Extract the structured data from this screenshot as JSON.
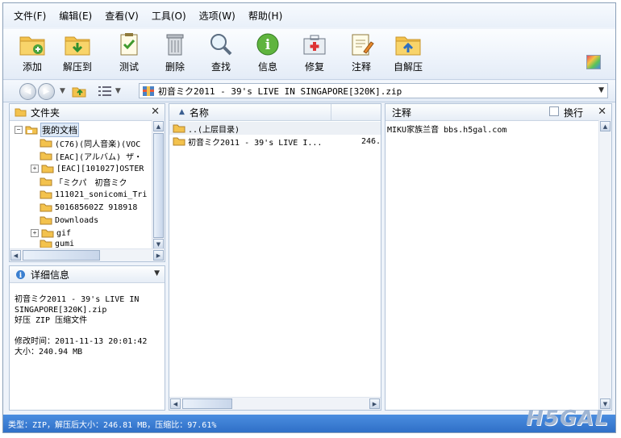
{
  "menu": [
    "文件(F)",
    "编辑(E)",
    "查看(V)",
    "工具(O)",
    "选项(W)",
    "帮助(H)"
  ],
  "toolbar": {
    "add": "添加",
    "extract_to": "解压到",
    "test": "测试",
    "delete": "删除",
    "find": "查找",
    "info": "信息",
    "repair": "修复",
    "comment": "注释",
    "self_extract": "自解压"
  },
  "address": {
    "path": "初音ミク2011 - 39's LIVE IN SINGAPORE[320K].zip"
  },
  "folder_pane": {
    "title": "文件夹",
    "root": "我的文档",
    "items": [
      "(C76)(同人音楽)(VOC",
      "[EAC](アルバム) ザ・",
      "[EAC][101027]OSTER",
      "「ミクパ　初音ミク",
      "111021_sonicomi_Tri",
      "501685602Z 918918",
      "Downloads",
      "gif",
      "gumi"
    ]
  },
  "details_pane": {
    "title": "详细信息",
    "name_line1": "初音ミク2011 - 39's LIVE IN",
    "name_line2": "SINGAPORE[320K].zip",
    "type": "好压 ZIP 压缩文件",
    "modified": "修改时间：2011-11-13 20:01:42",
    "size": "大小：240.94 MB"
  },
  "file_list": {
    "column_name": "名称",
    "rows": [
      {
        "name": "..(上层目录)",
        "size": ""
      },
      {
        "name": "初音ミク2011 - 39's LIVE I...",
        "size": "246."
      }
    ]
  },
  "comment_pane": {
    "title": "注释",
    "wrap_label": "换行",
    "text": "MIKU家族兰音 bbs.h5gal.com"
  },
  "status": "类型：ZIP，解压后大小：246.81 MB，压缩比：97.61%",
  "watermark": "H5GAL",
  "colors": {
    "accent": "#2f6fc7",
    "folder": "#f2c14b",
    "window_bg": "#eef3fa"
  }
}
